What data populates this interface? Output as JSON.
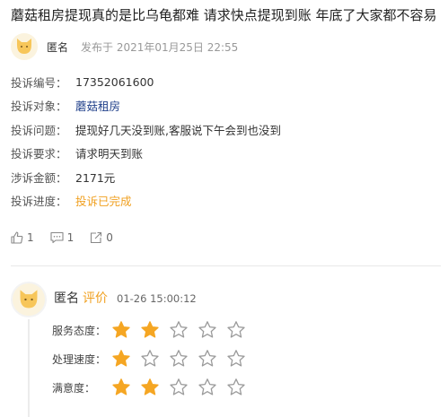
{
  "post": {
    "title": "蘑菇租房提现真的是比乌龟都难 请求快点提现到账 年底了大家都不容易",
    "author": "匿名",
    "published": "发布于 2021年01月25日 22:55"
  },
  "info": [
    {
      "label": "投诉编号：",
      "value": "17352061600"
    },
    {
      "label": "投诉对象：",
      "value": "蘑菇租房"
    },
    {
      "label": "投诉问题：",
      "value": "提现好几天没到账,客服说下午会到也没到"
    },
    {
      "label": "投诉要求：",
      "value": "请求明天到账"
    },
    {
      "label": "涉诉金额：",
      "value": "2171元"
    },
    {
      "label": "投诉进度：",
      "value": "投诉已完成"
    }
  ],
  "actions": {
    "like_count": "1",
    "comment_count": "1",
    "share_count": "0"
  },
  "review": {
    "author": "匿名",
    "tag": "评价",
    "time": "01-26 15:00:12",
    "ratings": [
      {
        "label": "服务态度：",
        "stars": 2,
        "max": 5
      },
      {
        "label": "处理速度：",
        "stars": 1,
        "max": 5
      },
      {
        "label": "满意度：",
        "stars": 2,
        "max": 5
      }
    ]
  },
  "colors": {
    "accent_orange": "#f0a020",
    "star_on": "#f5a623",
    "link_blue": "#1f3f8a"
  }
}
